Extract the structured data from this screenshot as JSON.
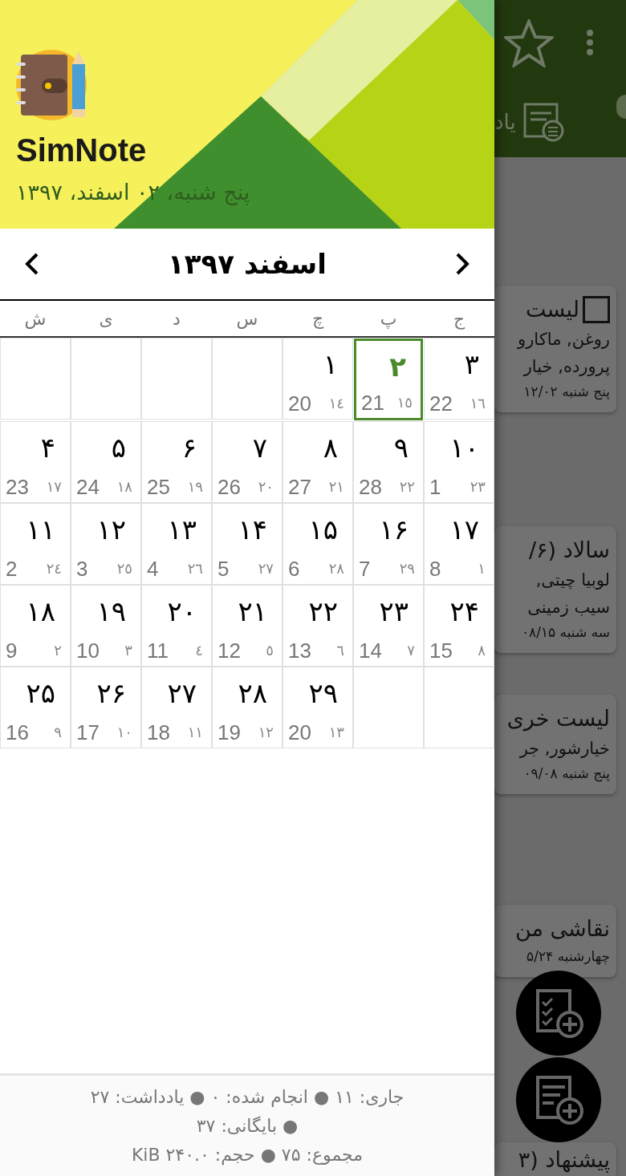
{
  "drawer": {
    "app_name": "SimNote",
    "date": "پنج شنبه، ۰۲ اسفند، ۱۳۹۷"
  },
  "calendar": {
    "month_title": "اسفند ۱۳۹۷",
    "weekdays": [
      "ج",
      "پ",
      "چ",
      "س",
      "د",
      "ی",
      "ش"
    ],
    "weeks": [
      [
        {
          "kind": "day",
          "day": "۳",
          "gregorian": "22",
          "hijri": "١٦",
          "selected": false
        },
        {
          "kind": "day",
          "day": "۲",
          "gregorian": "21",
          "hijri": "١٥",
          "selected": true
        },
        {
          "kind": "day",
          "day": "۱",
          "gregorian": "20",
          "hijri": "١٤",
          "selected": false
        },
        {
          "kind": "blank"
        },
        {
          "kind": "blank"
        },
        {
          "kind": "blank"
        },
        {
          "kind": "blank"
        }
      ],
      [
        {
          "kind": "day",
          "day": "۱۰",
          "gregorian": "1",
          "hijri": "٢٣",
          "selected": false
        },
        {
          "kind": "day",
          "day": "۹",
          "gregorian": "28",
          "hijri": "٢٢",
          "selected": false
        },
        {
          "kind": "day",
          "day": "۸",
          "gregorian": "27",
          "hijri": "٢١",
          "selected": false
        },
        {
          "kind": "day",
          "day": "۷",
          "gregorian": "26",
          "hijri": "٢٠",
          "selected": false
        },
        {
          "kind": "day",
          "day": "۶",
          "gregorian": "25",
          "hijri": "١٩",
          "selected": false
        },
        {
          "kind": "day",
          "day": "۵",
          "gregorian": "24",
          "hijri": "١٨",
          "selected": false
        },
        {
          "kind": "day",
          "day": "۴",
          "gregorian": "23",
          "hijri": "١٧",
          "selected": false
        }
      ],
      [
        {
          "kind": "day",
          "day": "۱۷",
          "gregorian": "8",
          "hijri": "١",
          "selected": false
        },
        {
          "kind": "day",
          "day": "۱۶",
          "gregorian": "7",
          "hijri": "٢٩",
          "selected": false
        },
        {
          "kind": "day",
          "day": "۱۵",
          "gregorian": "6",
          "hijri": "٢٨",
          "selected": false
        },
        {
          "kind": "day",
          "day": "۱۴",
          "gregorian": "5",
          "hijri": "٢٧",
          "selected": false
        },
        {
          "kind": "day",
          "day": "۱۳",
          "gregorian": "4",
          "hijri": "٢٦",
          "selected": false
        },
        {
          "kind": "day",
          "day": "۱۲",
          "gregorian": "3",
          "hijri": "٢٥",
          "selected": false
        },
        {
          "kind": "day",
          "day": "۱۱",
          "gregorian": "2",
          "hijri": "٢٤",
          "selected": false
        }
      ],
      [
        {
          "kind": "day",
          "day": "۲۴",
          "gregorian": "15",
          "hijri": "٨",
          "selected": false
        },
        {
          "kind": "day",
          "day": "۲۳",
          "gregorian": "14",
          "hijri": "٧",
          "selected": false
        },
        {
          "kind": "day",
          "day": "۲۲",
          "gregorian": "13",
          "hijri": "٦",
          "selected": false
        },
        {
          "kind": "day",
          "day": "۲۱",
          "gregorian": "12",
          "hijri": "٥",
          "selected": false
        },
        {
          "kind": "day",
          "day": "۲۰",
          "gregorian": "11",
          "hijri": "٤",
          "selected": false
        },
        {
          "kind": "day",
          "day": "۱۹",
          "gregorian": "10",
          "hijri": "٣",
          "selected": false
        },
        {
          "kind": "day",
          "day": "۱۸",
          "gregorian": "9",
          "hijri": "٢",
          "selected": false
        }
      ],
      [
        {
          "kind": "blank"
        },
        {
          "kind": "blank"
        },
        {
          "kind": "day",
          "day": "۲۹",
          "gregorian": "20",
          "hijri": "١٣",
          "selected": false
        },
        {
          "kind": "day",
          "day": "۲۸",
          "gregorian": "19",
          "hijri": "١٢",
          "selected": false
        },
        {
          "kind": "day",
          "day": "۲۷",
          "gregorian": "18",
          "hijri": "١١",
          "selected": false
        },
        {
          "kind": "day",
          "day": "۲۶",
          "gregorian": "17",
          "hijri": "١٠",
          "selected": false
        },
        {
          "kind": "day",
          "day": "۲۵",
          "gregorian": "16",
          "hijri": "٩",
          "selected": false
        }
      ]
    ]
  },
  "stats": {
    "lines": [
      "جاری: ۱۱ ● انجام شده: ۰ ● یادداشت: ۲۷",
      "● بایگانی: ۳۷",
      "مجموع: ۷۵ ● حجم: ۲۴۰.۰ KiB"
    ]
  },
  "background": {
    "tab_label": "یاد",
    "notes": [
      {
        "kind": "checklist",
        "checked": false,
        "title": "لیست",
        "lines": [
          "روغن, ماکارو",
          "پرورده, خیار"
        ],
        "date": "پنج شنبه ۱۲/۰۲"
      },
      {
        "kind": "note",
        "title": "سالاد (۶/",
        "lines": [
          "لوبیا چیتی,",
          "سیب زمینی"
        ],
        "date": "سه شنبه ۰۸/۱۵"
      },
      {
        "kind": "note",
        "title": "لیست خری",
        "lines": [
          "خیارشور, جر"
        ],
        "date": "پنج شنبه ۰۹/۰۸"
      },
      {
        "kind": "note",
        "title": "نقاشی من",
        "date": "چهارشنبه ۵/۲۴"
      },
      {
        "kind": "note",
        "title": "پیشنهاد (۳"
      }
    ]
  }
}
